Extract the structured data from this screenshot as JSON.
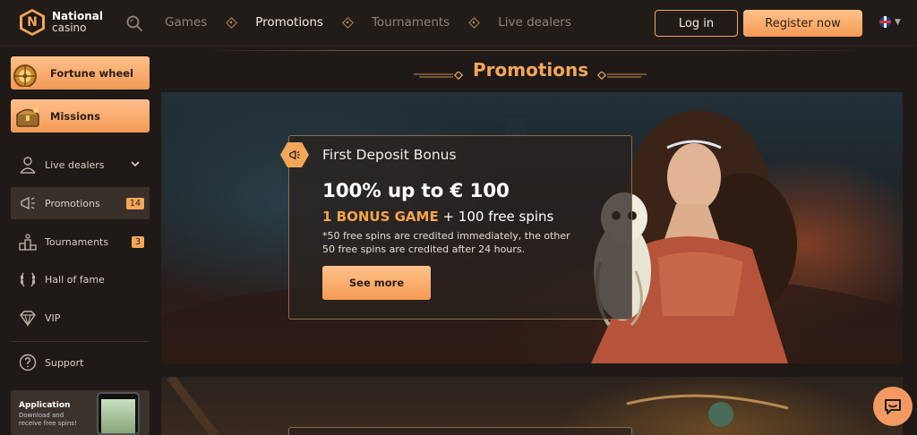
{
  "header": {
    "logo_line1": "National",
    "logo_line2": "casino",
    "logo_letter": "N",
    "nav": [
      "Games",
      "Promotions",
      "Tournaments",
      "Live dealers"
    ],
    "active_nav": "Promotions",
    "login_label": "Log in",
    "register_label": "Register now",
    "language": "uk-flag-icon"
  },
  "sidebar": {
    "promo_buttons": [
      {
        "label": "Fortune wheel",
        "icon": "fortune-wheel-icon"
      },
      {
        "label": "Missions",
        "icon": "treasure-chest-icon"
      }
    ],
    "items": [
      {
        "label": "Live dealers",
        "icon": "live-dealer-icon",
        "dropdown": true
      },
      {
        "label": "Promotions",
        "icon": "megaphone-icon",
        "count": "14",
        "active": true
      },
      {
        "label": "Tournaments",
        "icon": "podium-icon",
        "count": "3"
      },
      {
        "label": "Hall of fame",
        "icon": "laurel-icon"
      },
      {
        "label": "VIP",
        "icon": "diamond-icon"
      },
      {
        "label": "Support",
        "icon": "question-icon"
      }
    ],
    "app_card": {
      "title": "Application",
      "subtitle": "Download and receive free spins!"
    }
  },
  "main": {
    "page_title": "Promotions",
    "offer": {
      "heading": "First Deposit Bonus",
      "amount": "100% up to € 100",
      "highlight": "1 BONUS GAME",
      "extra": " + 100 free spins",
      "note": "*50 free spins are credited immediately, the other 50 free spins are credited after 24 hours.",
      "button": "See more"
    }
  },
  "colors": {
    "accent": "#f2a65a",
    "background": "#1f1a17",
    "highlight_text": "#f7a54a"
  },
  "chat_icon": "chat-bubble-icon"
}
